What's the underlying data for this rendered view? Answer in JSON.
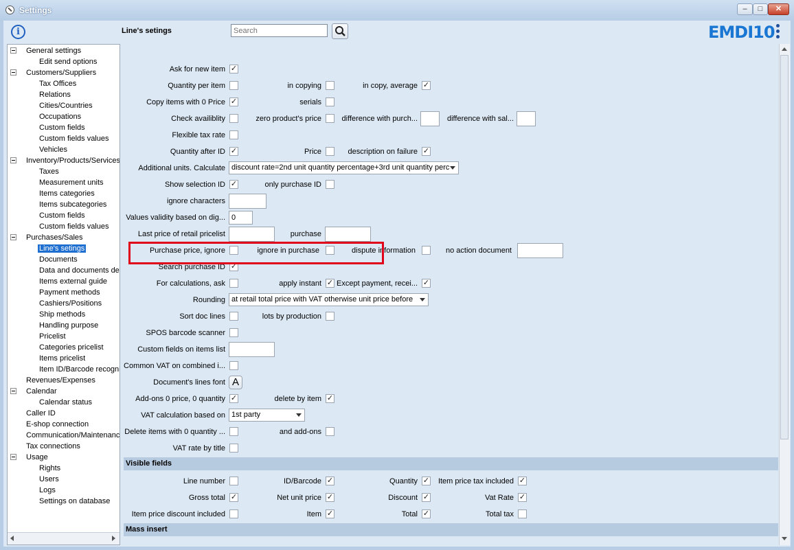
{
  "window": {
    "title": "Settings",
    "minimize": "–",
    "maximize": "□",
    "close": "✕"
  },
  "header": {
    "page_title": "Line's setings",
    "search_placeholder": "Search",
    "logo": "EMDI10",
    "info_icon": "info-icon",
    "menu_icon": "kebab-menu-icon"
  },
  "tree": [
    {
      "label": "General settings",
      "level": 0,
      "expandable": true
    },
    {
      "label": "Edit send options",
      "level": 1
    },
    {
      "label": "Customers/Suppliers",
      "level": 0,
      "expandable": true
    },
    {
      "label": "Tax Offices",
      "level": 1
    },
    {
      "label": "Relations",
      "level": 1
    },
    {
      "label": "Cities/Countries",
      "level": 1
    },
    {
      "label": "Occupations",
      "level": 1
    },
    {
      "label": "Custom fields",
      "level": 1
    },
    {
      "label": "Custom fields values",
      "level": 1
    },
    {
      "label": "Vehicles",
      "level": 1
    },
    {
      "label": "Inventory/Products/Services",
      "level": 0,
      "expandable": true
    },
    {
      "label": "Taxes",
      "level": 1
    },
    {
      "label": "Measurement units",
      "level": 1
    },
    {
      "label": "Items categories",
      "level": 1
    },
    {
      "label": "Items subcategories",
      "level": 1
    },
    {
      "label": "Custom fields",
      "level": 1
    },
    {
      "label": "Custom fields values",
      "level": 1
    },
    {
      "label": "Purchases/Sales",
      "level": 0,
      "expandable": true
    },
    {
      "label": "Line's setings",
      "level": 1,
      "selected": true
    },
    {
      "label": "Documents",
      "level": 1
    },
    {
      "label": "Data and documents desi",
      "level": 1
    },
    {
      "label": "Items external guide",
      "level": 1
    },
    {
      "label": "Payment methods",
      "level": 1
    },
    {
      "label": "Cashiers/Positions",
      "level": 1
    },
    {
      "label": "Ship methods",
      "level": 1
    },
    {
      "label": "Handling purpose",
      "level": 1
    },
    {
      "label": "Pricelist",
      "level": 1
    },
    {
      "label": "Categories pricelist",
      "level": 1
    },
    {
      "label": "Items pricelist",
      "level": 1
    },
    {
      "label": "Item ID/Barcode recognize",
      "level": 1
    },
    {
      "label": "Revenues/Expenses",
      "level": 0
    },
    {
      "label": "Calendar",
      "level": 0,
      "expandable": true
    },
    {
      "label": "Calendar status",
      "level": 1
    },
    {
      "label": "Caller ID",
      "level": 0
    },
    {
      "label": "E-shop connection",
      "level": 0
    },
    {
      "label": "Communication/Maintenance",
      "level": 0
    },
    {
      "label": "Tax connections",
      "level": 0
    },
    {
      "label": "Usage",
      "level": 0,
      "expandable": true
    },
    {
      "label": "Rights",
      "level": 1
    },
    {
      "label": "Users",
      "level": 1
    },
    {
      "label": "Logs",
      "level": 1
    },
    {
      "label": "Settings on database",
      "level": 1
    }
  ],
  "form": {
    "ask_new_item": "Ask for new item",
    "qty_per_item": "Quantity per item",
    "in_copying": "in copying",
    "in_copy_average": "in copy, average",
    "copy_items_0": "Copy items with 0 Price",
    "serials": "serials",
    "check_avail": "Check availiblity",
    "zero_price": "zero product's price",
    "diff_purch": "difference with purch...",
    "diff_sal": "difference with sal...",
    "flex_tax": "Flexible tax rate",
    "qty_after_id": "Quantity after ID",
    "price": "Price",
    "desc_failure": "description on failure",
    "add_units": "Additional units. Calculate",
    "add_units_value": "discount rate=2nd unit quantity percentage+3rd unit quantity perc",
    "show_sel_id": "Show selection ID",
    "only_purch_id": "only purchase ID",
    "ignore_chars": "ignore characters",
    "values_validity": "Values validity based on dig...",
    "values_validity_value": "0",
    "last_price_retail": "Last price of retail pricelist",
    "purchase": "purchase",
    "purch_price_ignore": "Purchase price, ignore",
    "ignore_in_purchase": "ignore in purchase",
    "dispute_info": "dispute information",
    "no_action_doc": "no action document",
    "search_purch_id": "Search purchase ID",
    "for_calc_ask": "For calculations, ask",
    "apply_instant": "apply instant",
    "except_payment": "Except payment, recei...",
    "rounding": "Rounding",
    "rounding_value": "at retail total price with VAT otherwise unit price before",
    "sort_doc_lines": "Sort doc lines",
    "lots_by_production": "lots by production",
    "spos_barcode": "SPOS barcode scanner",
    "custom_fields_list": "Custom fields on items list",
    "common_vat": "Common VAT on combined i...",
    "doc_lines_font": "Document's lines font",
    "font_button": "A",
    "addons_0": "Add-ons 0 price, 0 quantity",
    "delete_by_item": "delete by item",
    "vat_calc": "VAT calculation based on",
    "vat_calc_value": "1st party",
    "delete_items_0": "Delete items with 0 quantity ...",
    "and_addons": "and add-ons",
    "vat_by_title": "VAT rate by title"
  },
  "visible_fields": {
    "title": "Visible fields",
    "line_number": "Line number",
    "id_barcode": "ID/Barcode",
    "quantity": "Quantity",
    "item_price_tax": "Item price tax included",
    "gross_total": "Gross total",
    "net_unit_price": "Net unit price",
    "discount": "Discount",
    "vat_rate": "Vat Rate",
    "item_price_discount": "Item price discount included",
    "item": "Item",
    "total": "Total",
    "total_tax": "Total tax"
  },
  "mass_insert": {
    "title": "Mass insert"
  },
  "check": "✓"
}
